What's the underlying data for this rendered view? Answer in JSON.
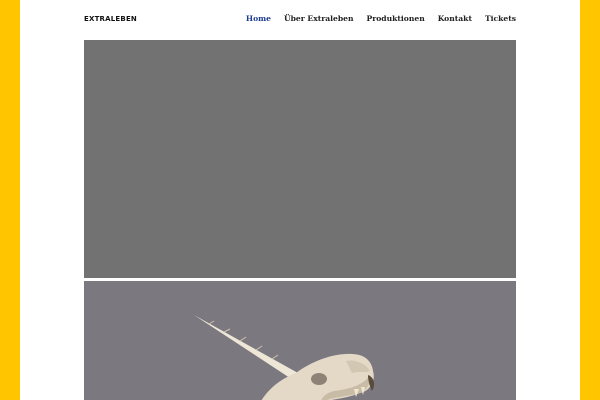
{
  "site": {
    "logo": "EXTRALEBEN"
  },
  "nav": {
    "items": [
      {
        "label": "Home",
        "active": true
      },
      {
        "label": "Über Extraleben",
        "active": false
      },
      {
        "label": "Produktionen",
        "active": false
      },
      {
        "label": "Kontakt",
        "active": false
      },
      {
        "label": "Tickets",
        "active": false
      }
    ]
  },
  "colors": {
    "frame": "#ffc600",
    "accent_link": "#1d3d8f",
    "top_panel": "#727272",
    "image_bg": "#7b7880"
  },
  "images": {
    "hero_bottom": "unicorn-skull-image"
  }
}
